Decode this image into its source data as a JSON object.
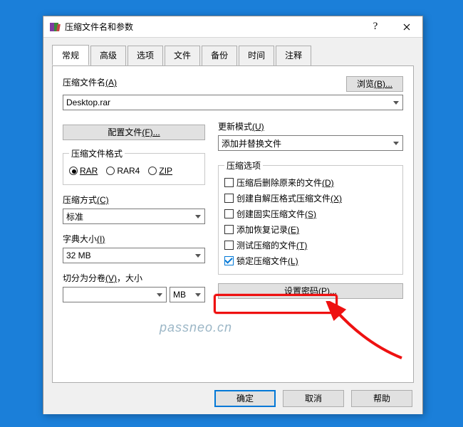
{
  "window": {
    "title": "压缩文件名和参数"
  },
  "tabs": {
    "general": "常规",
    "advanced": "高级",
    "options": "选项",
    "files": "文件",
    "backup": "备份",
    "time": "时间",
    "comment": "注释",
    "active": "general"
  },
  "filename": {
    "label": "压缩文件名",
    "accel": "(A)",
    "value": "Desktop.rar",
    "browse": "浏览",
    "browse_accel": "(B)..."
  },
  "profile": {
    "button": "配置文件",
    "accel": "(F)..."
  },
  "update_mode": {
    "label": "更新模式",
    "accel": "(U)",
    "value": "添加并替换文件"
  },
  "format": {
    "legend": "压缩文件格式",
    "rar": "RAR",
    "rar4": "RAR4",
    "zip": "ZIP",
    "selected": "rar"
  },
  "method": {
    "label": "压缩方式",
    "accel": "(C)",
    "value": "标准"
  },
  "dict": {
    "label": "字典大小",
    "accel": "(I)",
    "value": "32 MB"
  },
  "split": {
    "label": "切分为分卷",
    "accel": "(V)",
    "suffix": "，大小",
    "value": "",
    "unit": "MB"
  },
  "options": {
    "legend": "压缩选项",
    "items": [
      {
        "key": "delete_after",
        "label": "压缩后删除原来的文件",
        "accel": "(D)",
        "checked": false
      },
      {
        "key": "sfx",
        "label": "创建自解压格式压缩文件",
        "accel": "(X)",
        "checked": false
      },
      {
        "key": "solid",
        "label": "创建固实压缩文件",
        "accel": "(S)",
        "checked": false
      },
      {
        "key": "recovery",
        "label": "添加恢复记录",
        "accel": "(E)",
        "checked": false
      },
      {
        "key": "test",
        "label": "测试压缩的文件",
        "accel": "(T)",
        "checked": false
      },
      {
        "key": "lock",
        "label": "锁定压缩文件",
        "accel": "(L)",
        "checked": true
      }
    ]
  },
  "password": {
    "button": "设置密码",
    "accel": "(P)..."
  },
  "buttons": {
    "ok": "确定",
    "cancel": "取消",
    "help": "帮助"
  },
  "watermark": "passneo.cn"
}
